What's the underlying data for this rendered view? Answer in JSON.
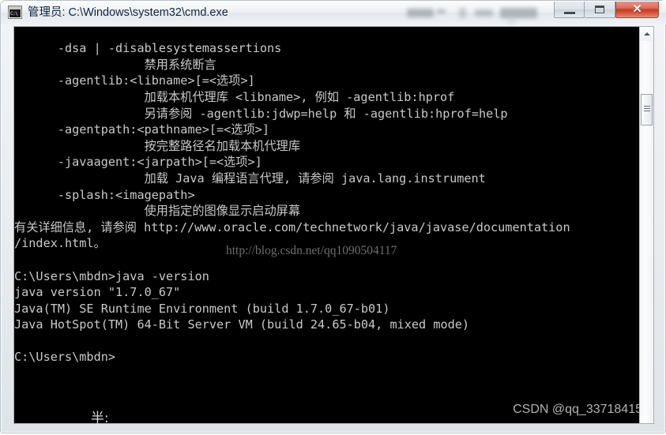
{
  "window": {
    "title": "管理员: C:\\Windows\\system32\\cmd.exe",
    "icon_label": "C:\\",
    "controls": {
      "minimize_label": "",
      "maximize_label": "",
      "close_label": "✕"
    }
  },
  "console": {
    "text": "      -dsa | -disablesystemassertions\n                  禁用系统断言\n      -agentlib:<libname>[=<选项>]\n                  加载本机代理库 <libname>, 例如 -agentlib:hprof\n                  另请参阅 -agentlib:jdwp=help 和 -agentlib:hprof=help\n      -agentpath:<pathname>[=<选项>]\n                  按完整路径名加载本机代理库\n      -javaagent:<jarpath>[=<选项>]\n                  加载 Java 编程语言代理, 请参阅 java.lang.instrument\n      -splash:<imagepath>\n                  使用指定的图像显示启动屏幕\n有关详细信息, 请参阅 http://www.oracle.com/technetwork/java/javase/documentation\n/index.html。\n\nC:\\Users\\mbdn>java -version\njava version \"1.7.0_67\"\nJava(TM) SE Runtime Environment (build 1.7.0_67-b01)\nJava HotSpot(TM) 64-Bit Server VM (build 24.65-b04, mixed mode)\n\nC:\\Users\\mbdn>",
    "blog_watermark": "http://blog.csdn.net/qq1090504117",
    "bottom_glyph": "半:"
  },
  "watermark": {
    "csdn": "CSDN @qq_33718415"
  },
  "scrollbar": {
    "up_arrow": "▲"
  },
  "colors": {
    "console_background": "#000000",
    "console_foreground": "#c9c9c9",
    "close_button": "#c43a20",
    "title_text": "#12263f"
  }
}
